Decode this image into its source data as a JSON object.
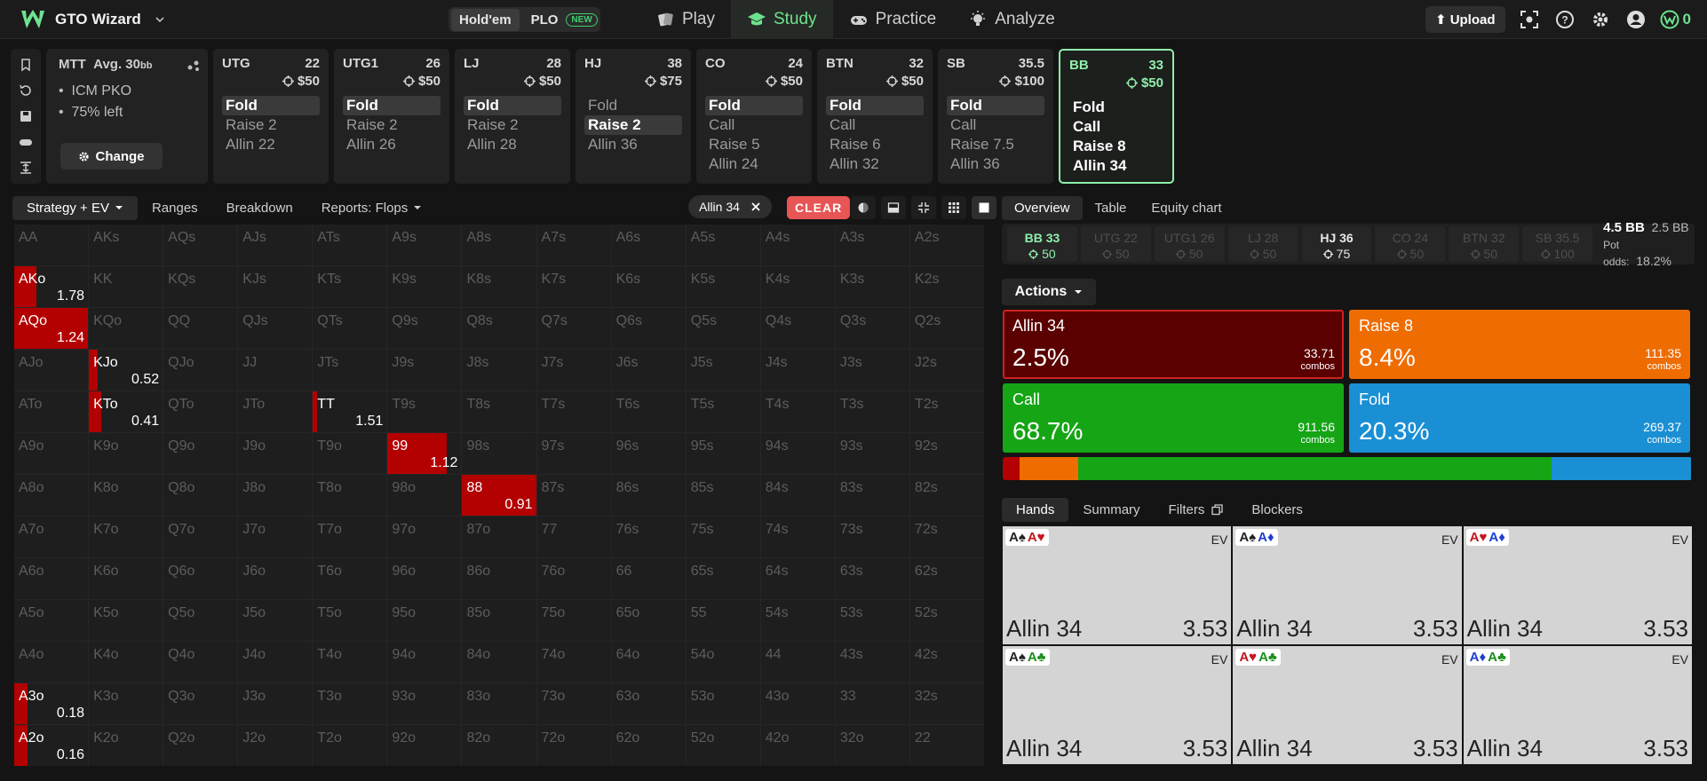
{
  "app": {
    "title": "GTO Wizard",
    "credits": "0"
  },
  "game_select": {
    "holdem": "Hold'em",
    "plo": "PLO",
    "plo_badge": "NEW"
  },
  "nav": [
    "Play",
    "Study",
    "Practice",
    "Analyze"
  ],
  "right_nav": {
    "upload": "Upload"
  },
  "info": {
    "title": "MTT",
    "avg": "Avg. 30",
    "avg_unit": "bb",
    "lines": [
      "ICM PKO",
      "75% left"
    ],
    "change": "Change"
  },
  "positions": [
    {
      "name": "UTG",
      "stack": "22",
      "bounty": "$50",
      "actions": [
        "Fold",
        "Raise 2",
        "Allin 22"
      ],
      "selected": 0
    },
    {
      "name": "UTG1",
      "stack": "26",
      "bounty": "$50",
      "actions": [
        "Fold",
        "Raise 2",
        "Allin 26"
      ],
      "selected": 0
    },
    {
      "name": "LJ",
      "stack": "28",
      "bounty": "$50",
      "actions": [
        "Fold",
        "Raise 2",
        "Allin 28"
      ],
      "selected": 0
    },
    {
      "name": "HJ",
      "stack": "38",
      "bounty": "$75",
      "actions": [
        "Fold",
        "Raise 2",
        "Allin 36"
      ],
      "selected": 1
    },
    {
      "name": "CO",
      "stack": "24",
      "bounty": "$50",
      "actions": [
        "Fold",
        "Call",
        "Raise 5",
        "Allin 24"
      ],
      "selected": 0
    },
    {
      "name": "BTN",
      "stack": "32",
      "bounty": "$50",
      "actions": [
        "Fold",
        "Call",
        "Raise 6",
        "Allin 32"
      ],
      "selected": 0
    },
    {
      "name": "SB",
      "stack": "35.5",
      "bounty": "$100",
      "actions": [
        "Fold",
        "Call",
        "Raise 7.5",
        "Allin 36"
      ],
      "selected": 0
    },
    {
      "name": "BB",
      "stack": "33",
      "bounty": "$50",
      "actions": [
        "Fold",
        "Call",
        "Raise 8",
        "Allin 34"
      ],
      "selected": -1,
      "active": true
    }
  ],
  "left_tabs": {
    "strategy": "Strategy + EV",
    "ranges": "Ranges",
    "breakdown": "Breakdown",
    "reports": "Reports: Flops"
  },
  "filter_chip": "Allin 34",
  "clear": "CLEAR",
  "matrix": {
    "labels": [
      [
        "AA",
        "AKs",
        "AQs",
        "AJs",
        "ATs",
        "A9s",
        "A8s",
        "A7s",
        "A6s",
        "A5s",
        "A4s",
        "A3s",
        "A2s"
      ],
      [
        "AKo",
        "KK",
        "KQs",
        "KJs",
        "KTs",
        "K9s",
        "K8s",
        "K7s",
        "K6s",
        "K5s",
        "K4s",
        "K3s",
        "K2s"
      ],
      [
        "AQo",
        "KQo",
        "QQ",
        "QJs",
        "QTs",
        "Q9s",
        "Q8s",
        "Q7s",
        "Q6s",
        "Q5s",
        "Q4s",
        "Q3s",
        "Q2s"
      ],
      [
        "AJo",
        "KJo",
        "QJo",
        "JJ",
        "JTs",
        "J9s",
        "J8s",
        "J7s",
        "J6s",
        "J5s",
        "J4s",
        "J3s",
        "J2s"
      ],
      [
        "ATo",
        "KTo",
        "QTo",
        "JTo",
        "TT",
        "T9s",
        "T8s",
        "T7s",
        "T6s",
        "T5s",
        "T4s",
        "T3s",
        "T2s"
      ],
      [
        "A9o",
        "K9o",
        "Q9o",
        "J9o",
        "T9o",
        "99",
        "98s",
        "97s",
        "96s",
        "95s",
        "94s",
        "93s",
        "92s"
      ],
      [
        "A8o",
        "K8o",
        "Q8o",
        "J8o",
        "T8o",
        "98o",
        "88",
        "87s",
        "86s",
        "85s",
        "84s",
        "83s",
        "82s"
      ],
      [
        "A7o",
        "K7o",
        "Q7o",
        "J7o",
        "T7o",
        "97o",
        "87o",
        "77",
        "76s",
        "75s",
        "74s",
        "73s",
        "72s"
      ],
      [
        "A6o",
        "K6o",
        "Q6o",
        "J6o",
        "T6o",
        "96o",
        "86o",
        "76o",
        "66",
        "65s",
        "64s",
        "63s",
        "62s"
      ],
      [
        "A5o",
        "K5o",
        "Q5o",
        "J5o",
        "T5o",
        "95o",
        "85o",
        "75o",
        "65o",
        "55",
        "54s",
        "53s",
        "52s"
      ],
      [
        "A4o",
        "K4o",
        "Q4o",
        "J4o",
        "T4o",
        "94o",
        "84o",
        "74o",
        "64o",
        "54o",
        "44",
        "43s",
        "42s"
      ],
      [
        "A3o",
        "K3o",
        "Q3o",
        "J3o",
        "T3o",
        "93o",
        "83o",
        "73o",
        "63o",
        "53o",
        "43o",
        "33",
        "32s"
      ],
      [
        "A2o",
        "K2o",
        "Q2o",
        "J2o",
        "T2o",
        "92o",
        "82o",
        "72o",
        "62o",
        "52o",
        "42o",
        "32o",
        "22"
      ]
    ],
    "highlights": [
      {
        "hand": "AKo",
        "ev": "1.78",
        "fill": 0.3
      },
      {
        "hand": "AQo",
        "ev": "1.24",
        "fill": 1.0
      },
      {
        "hand": "KJo",
        "ev": "0.52",
        "fill": 0.12
      },
      {
        "hand": "KTo",
        "ev": "0.41",
        "fill": 0.17
      },
      {
        "hand": "TT",
        "ev": "1.51",
        "fill": 0.06
      },
      {
        "hand": "99",
        "ev": "1.12",
        "fill": 0.8
      },
      {
        "hand": "88",
        "ev": "0.91",
        "fill": 1.0
      },
      {
        "hand": "A3o",
        "ev": "0.18",
        "fill": 0.18
      },
      {
        "hand": "A2o",
        "ev": "0.16",
        "fill": 0.18
      }
    ],
    "fill_color": "#b30000"
  },
  "right_tabs": [
    "Overview",
    "Table",
    "Equity chart"
  ],
  "seats": [
    {
      "name": "BB 33",
      "bounty": "50",
      "state": "hero"
    },
    {
      "name": "UTG 22",
      "bounty": "50",
      "state": "dim"
    },
    {
      "name": "UTG1 26",
      "bounty": "50",
      "state": "dim"
    },
    {
      "name": "LJ 28",
      "bounty": "50",
      "state": "dim"
    },
    {
      "name": "HJ 36",
      "bounty": "75",
      "state": "hl"
    },
    {
      "name": "CO 24",
      "bounty": "50",
      "state": "dim"
    },
    {
      "name": "BTN 32",
      "bounty": "50",
      "state": "dim"
    },
    {
      "name": "SB 35.5",
      "bounty": "100",
      "state": "dim"
    }
  ],
  "pot": {
    "pot": "4.5 BB",
    "call": "2.5 BB",
    "odds_label": "Pot odds:",
    "odds": "18.2%"
  },
  "actions_label": "Actions",
  "actions": [
    {
      "name": "Allin 34",
      "pct": "2.5%",
      "combos": "33.71",
      "color": "#5a0000",
      "border": "#d02020"
    },
    {
      "name": "Raise 8",
      "pct": "8.4%",
      "combos": "111.35",
      "color": "#ef6c00",
      "border": "#ef6c00"
    },
    {
      "name": "Call",
      "pct": "68.7%",
      "combos": "911.56",
      "color": "#15a515",
      "border": "#15a515"
    },
    {
      "name": "Fold",
      "pct": "20.3%",
      "combos": "269.37",
      "color": "#1a8fd4",
      "border": "#1a8fd4"
    }
  ],
  "combos_word": "combos",
  "bar": [
    {
      "pct": 2.5,
      "color": "#b30000"
    },
    {
      "pct": 8.4,
      "color": "#ef6c00"
    },
    {
      "pct": 68.7,
      "color": "#15a515"
    },
    {
      "pct": 20.3,
      "color": "#1a8fd4"
    }
  ],
  "hand_tabs": [
    "Hands",
    "Summary",
    "Filters",
    "Blockers"
  ],
  "hands": [
    {
      "c1": "A♠",
      "c1c": "blk",
      "c2": "A♥",
      "c2c": "red",
      "action": "Allin 34",
      "ev": "3.53"
    },
    {
      "c1": "A♠",
      "c1c": "blk",
      "c2": "A♦",
      "c2c": "blu",
      "action": "Allin 34",
      "ev": "3.53"
    },
    {
      "c1": "A♥",
      "c1c": "red",
      "c2": "A♦",
      "c2c": "blu",
      "action": "Allin 34",
      "ev": "3.53"
    },
    {
      "c1": "A♠",
      "c1c": "blk",
      "c2": "A♣",
      "c2c": "grn",
      "action": "Allin 34",
      "ev": "3.53"
    },
    {
      "c1": "A♥",
      "c1c": "red",
      "c2": "A♣",
      "c2c": "grn",
      "action": "Allin 34",
      "ev": "3.53"
    },
    {
      "c1": "A♦",
      "c1c": "blu",
      "c2": "A♣",
      "c2c": "grn",
      "action": "Allin 34",
      "ev": "3.53"
    }
  ],
  "ev_label": "EV"
}
